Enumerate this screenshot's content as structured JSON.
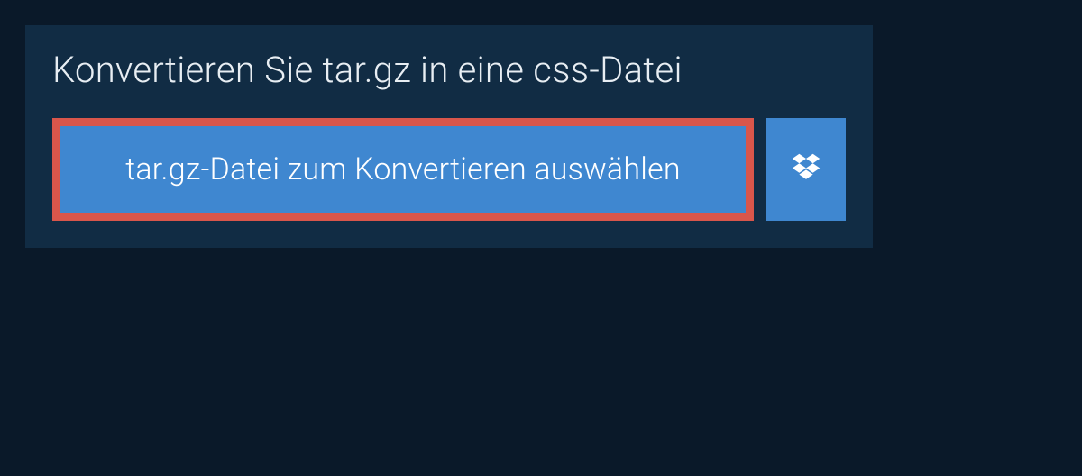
{
  "heading": "Konvertieren Sie tar.gz in eine css-Datei",
  "buttons": {
    "select_file_label": "tar.gz-Datei zum Konvertieren auswählen"
  },
  "icons": {
    "dropbox": "dropbox-icon"
  },
  "colors": {
    "background": "#0a1929",
    "panel": "#112c44",
    "button_primary": "#3f87d0",
    "highlight_border": "#d9564b",
    "text_heading": "#e8eef3",
    "text_button": "#ffffff"
  }
}
